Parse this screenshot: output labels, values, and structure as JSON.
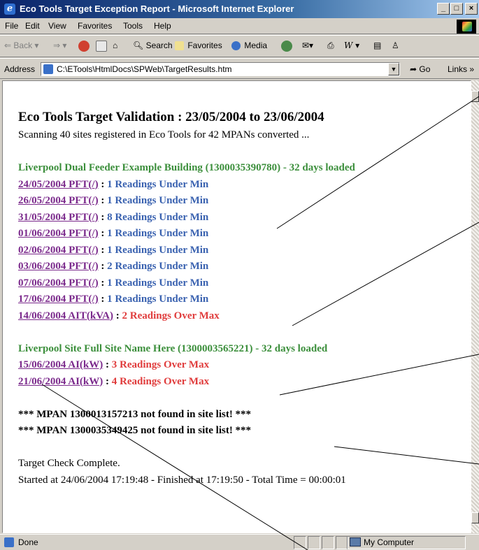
{
  "window": {
    "title": "Eco Tools Target Exception Report - Microsoft Internet Explorer",
    "controls": {
      "minimize": "_",
      "maximize": "□",
      "close": "×"
    }
  },
  "menu": [
    "File",
    "Edit",
    "View",
    "Favorites",
    "Tools",
    "Help"
  ],
  "toolbar": {
    "back": "Back",
    "search": "Search",
    "favorites": "Favorites",
    "media": "Media"
  },
  "address": {
    "label": "Address",
    "url": "C:\\ETools\\HtmlDocs\\SPWeb\\TargetResults.htm",
    "go": "Go",
    "links": "Links"
  },
  "report": {
    "heading": "Eco Tools Target Validation : 23/05/2004 to 23/06/2004",
    "scan_line": "Scanning 40 sites registered in Eco Tools for 42 MPANs converted ...",
    "sites": [
      {
        "name": "Liverpool Dual Feeder Example Building (1300035390780) - 32 days loaded",
        "rows": [
          {
            "link": "24/05/2004 PFT(/)",
            "sep": " : ",
            "result": "1 Readings Under Min",
            "kind": "under"
          },
          {
            "link": "26/05/2004 PFT(/)",
            "sep": " : ",
            "result": "1 Readings Under Min",
            "kind": "under"
          },
          {
            "link": "31/05/2004 PFT(/)",
            "sep": " : ",
            "result": "8 Readings Under Min",
            "kind": "under"
          },
          {
            "link": "01/06/2004 PFT(/)",
            "sep": " : ",
            "result": "1 Readings Under Min",
            "kind": "under"
          },
          {
            "link": "02/06/2004 PFT(/)",
            "sep": " : ",
            "result": "1 Readings Under Min",
            "kind": "under"
          },
          {
            "link": "03/06/2004 PFT(/)",
            "sep": " : ",
            "result": "2 Readings Under Min",
            "kind": "under"
          },
          {
            "link": "07/06/2004 PFT(/)",
            "sep": " : ",
            "result": "1 Readings Under Min",
            "kind": "under"
          },
          {
            "link": "17/06/2004 PFT(/)",
            "sep": " : ",
            "result": "1 Readings Under Min",
            "kind": "under"
          },
          {
            "link": "14/06/2004 AIT(kVA)",
            "sep": " : ",
            "result": "2 Readings Over Max",
            "kind": "over"
          }
        ]
      },
      {
        "name": "Liverpool Site Full Site Name Here (1300003565221) - 32 days loaded",
        "rows": [
          {
            "link": "15/06/2004 AI(kW)",
            "sep": " : ",
            "result": "3 Readings Over Max",
            "kind": "over"
          },
          {
            "link": "21/06/2004 AI(kW)",
            "sep": " : ",
            "result": "4 Readings Over Max",
            "kind": "over"
          }
        ]
      }
    ],
    "errors": [
      "*** MPAN 1300013157213 not found in site list! ***",
      "*** MPAN 1300035349425 not found in site list! ***"
    ],
    "complete": "Target Check Complete.",
    "timing": "Started at 24/06/2004 17:19:48 - Finished at 17:19:50 - Total Time = 00:00:01"
  },
  "status": {
    "text": "Done",
    "zone": "My Computer"
  },
  "colors": {
    "site": "#3c8f3c",
    "link": "#7b2a8c",
    "under": "#3a62b0",
    "over": "#e03c3c",
    "titlebar": "#0a246a"
  }
}
